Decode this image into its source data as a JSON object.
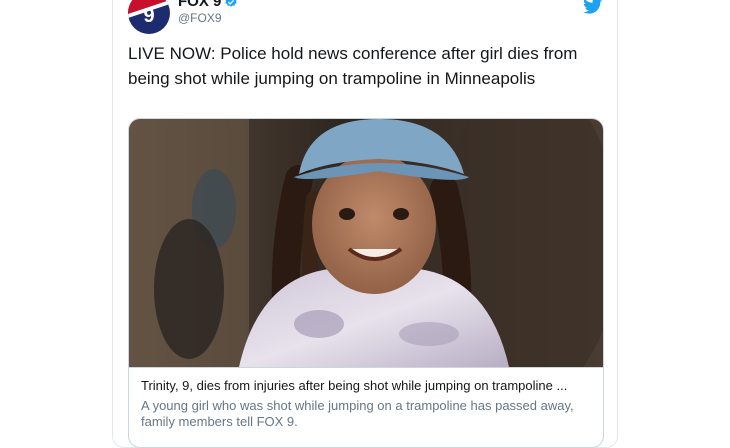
{
  "account": {
    "display_name": "FOX 9",
    "handle": "@FOX9",
    "avatar_number": "9",
    "verified_icon": "verified-badge-icon",
    "brand_color": "#1d2c6e"
  },
  "tweet": {
    "text": "LIVE NOW: Police hold news conference after girl dies from being shot while jumping on trampoline in Minneapolis"
  },
  "card": {
    "title": "Trinity, 9, dies from injuries after being shot while jumping on trampoline ...",
    "description": "A young girl who was shot while jumping on a trampoline has passed away, family members tell FOX 9."
  },
  "colors": {
    "twitter_blue": "#1da1f2",
    "text_primary": "#14171a",
    "text_secondary": "#657786"
  }
}
